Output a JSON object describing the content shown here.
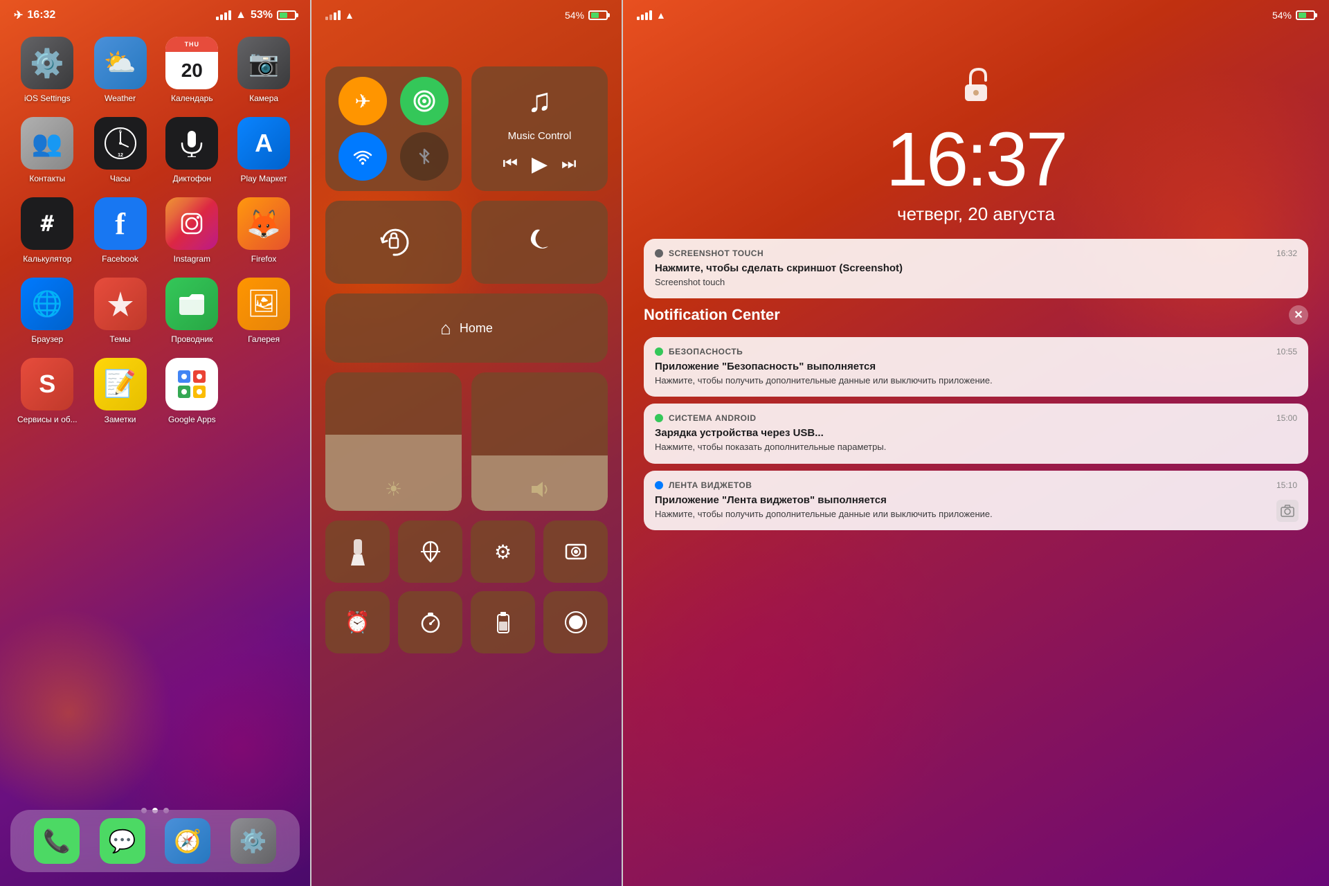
{
  "panel1": {
    "statusBar": {
      "time": "16:32",
      "signal": "●●●",
      "wifi": "▲",
      "battery": "53%",
      "batteryLevel": 53,
      "airplane": "✈"
    },
    "apps": [
      {
        "id": "ios-settings",
        "label": "iOS Settings",
        "icon": "⚙️",
        "type": "settings"
      },
      {
        "id": "weather",
        "label": "Weather",
        "icon": "🌤",
        "type": "weather"
      },
      {
        "id": "calendar",
        "label": "Календарь",
        "icon": "📅",
        "type": "calendar",
        "calDay": "20",
        "calMonth": "THU"
      },
      {
        "id": "camera",
        "label": "Камера",
        "icon": "📷",
        "type": "camera"
      },
      {
        "id": "contacts",
        "label": "Контакты",
        "icon": "👥",
        "type": "contacts"
      },
      {
        "id": "clock",
        "label": "Часы",
        "icon": "🕐",
        "type": "clock"
      },
      {
        "id": "voice",
        "label": "Диктофон",
        "icon": "🎤",
        "type": "voice"
      },
      {
        "id": "appstore",
        "label": "Play Маркет",
        "icon": "🅐",
        "type": "appstore"
      },
      {
        "id": "calc",
        "label": "Калькулятор",
        "icon": "#",
        "type": "calc"
      },
      {
        "id": "facebook",
        "label": "Facebook",
        "icon": "f",
        "type": "facebook"
      },
      {
        "id": "instagram",
        "label": "Instagram",
        "icon": "📷",
        "type": "instagram"
      },
      {
        "id": "firefox",
        "label": "Firefox",
        "icon": "🦊",
        "type": "firefox"
      },
      {
        "id": "browser",
        "label": "Браузер",
        "icon": "🌐",
        "type": "browser"
      },
      {
        "id": "themes",
        "label": "Темы",
        "icon": "🎨",
        "type": "themes"
      },
      {
        "id": "explorer",
        "label": "Проводник",
        "icon": "📁",
        "type": "explorer"
      },
      {
        "id": "gallery",
        "label": "Галерея",
        "icon": "🖼",
        "type": "gallery"
      },
      {
        "id": "services",
        "label": "Сервисы и об...",
        "icon": "🔧",
        "type": "services"
      },
      {
        "id": "notes",
        "label": "Заметки",
        "icon": "📝",
        "type": "notes"
      },
      {
        "id": "googleapps",
        "label": "Google Apps",
        "icon": "G",
        "type": "googleapps"
      }
    ],
    "dock": [
      {
        "id": "phone",
        "label": "Phone",
        "icon": "📞",
        "type": "phone"
      },
      {
        "id": "messages",
        "label": "Messages",
        "icon": "💬",
        "type": "messages"
      },
      {
        "id": "safari",
        "label": "Safari",
        "icon": "🧭",
        "type": "safari"
      },
      {
        "id": "settings",
        "label": "Settings",
        "icon": "⚙️",
        "type": "settings-dock"
      }
    ],
    "pageDots": 3,
    "activePageDot": 1
  },
  "panel2": {
    "statusBar": {
      "battery": "54%",
      "batteryLevel": 54
    },
    "controls": {
      "airplaneMode": "✈",
      "cellular": "📶",
      "wifi": "WiFi",
      "bluetooth": "Bluetooth",
      "musicLabel": "Music Control",
      "musicNote": "♪",
      "prevTrack": "⏮",
      "play": "▶",
      "nextTrack": "⏭",
      "rotate": "🔄",
      "moon": "🌙",
      "homeLabel": "Home",
      "homeIcon": "⌂",
      "brightness": "☀",
      "volume": "🔊",
      "flashlight": "🔦",
      "location": "📍",
      "settingsIcon": "⚙",
      "screenCapture": "📷",
      "alarm": "⏰",
      "stopwatch": "⏱",
      "battery": "🔋",
      "record": "⏺"
    }
  },
  "panel3": {
    "statusBar": {
      "wifi": "WiFi",
      "battery": "54%",
      "batteryLevel": 54
    },
    "lockIcon": "🔓",
    "time": "16:37",
    "date": "четверг, 20 августа",
    "notifications": {
      "first": {
        "appName": "SCREENSHOT TOUCH",
        "appColor": "#636366",
        "time": "16:32",
        "title": "Нажмите, чтобы сделать скриншот (Screenshot)",
        "body": "Screenshot touch"
      },
      "center": {
        "title": "Notification Center"
      },
      "items": [
        {
          "appName": "БЕЗОПАСНОСТЬ",
          "appColor": "#34c759",
          "time": "10:55",
          "title": "Приложение \"Безопасность\" выполняется",
          "body": "Нажмите, чтобы получить дополнительные данные или выключить приложение."
        },
        {
          "appName": "СИСТЕМА ANDROID",
          "appColor": "#34c759",
          "time": "15:00",
          "title": "Зарядка устройства через USB...",
          "body": "Нажмите, чтобы показать дополнительные параметры."
        },
        {
          "appName": "ЛЕНТА ВИДЖЕТОВ",
          "appColor": "#007aff",
          "time": "15:10",
          "title": "Приложение \"Лента виджетов\" выполняется",
          "body": "Нажмите, чтобы получить дополнительные данные или выключить приложение."
        }
      ]
    }
  }
}
